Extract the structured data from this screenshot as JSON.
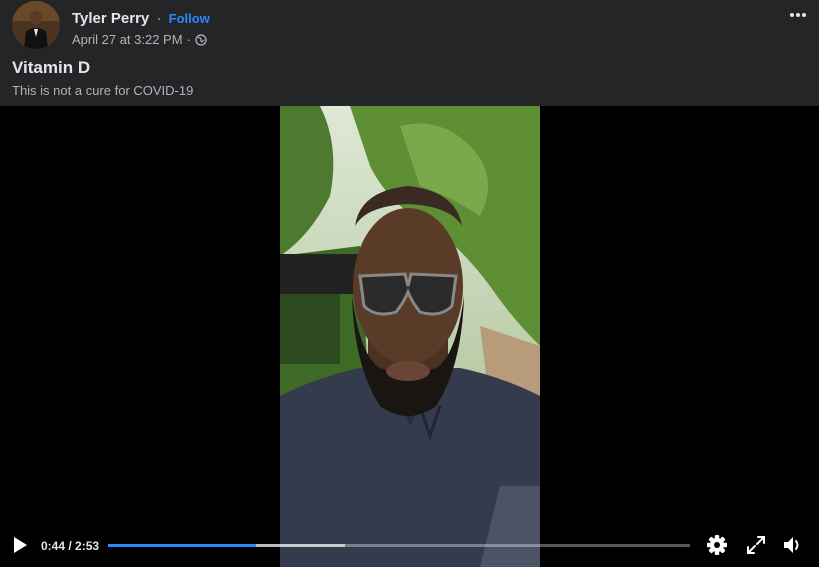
{
  "post": {
    "author": "Tyler Perry",
    "separator": "·",
    "follow_label": "Follow",
    "timestamp": "April 27 at 3:22 PM",
    "separator2": "·",
    "audience_icon": "globe-icon",
    "more_icon": "more-options-icon",
    "title": "Vitamin D",
    "subtitle": "This is not a cure for COVID-19"
  },
  "player": {
    "current_time": "0:44",
    "time_separator": " / ",
    "duration": "2:53",
    "played_fraction": 0.254,
    "buffered_fraction": 0.407,
    "icons": [
      "play-icon",
      "settings-icon",
      "fullscreen-icon",
      "volume-icon"
    ]
  },
  "colors": {
    "background": "#242526",
    "accent": "#2d88ff",
    "video_bg": "#000000"
  }
}
